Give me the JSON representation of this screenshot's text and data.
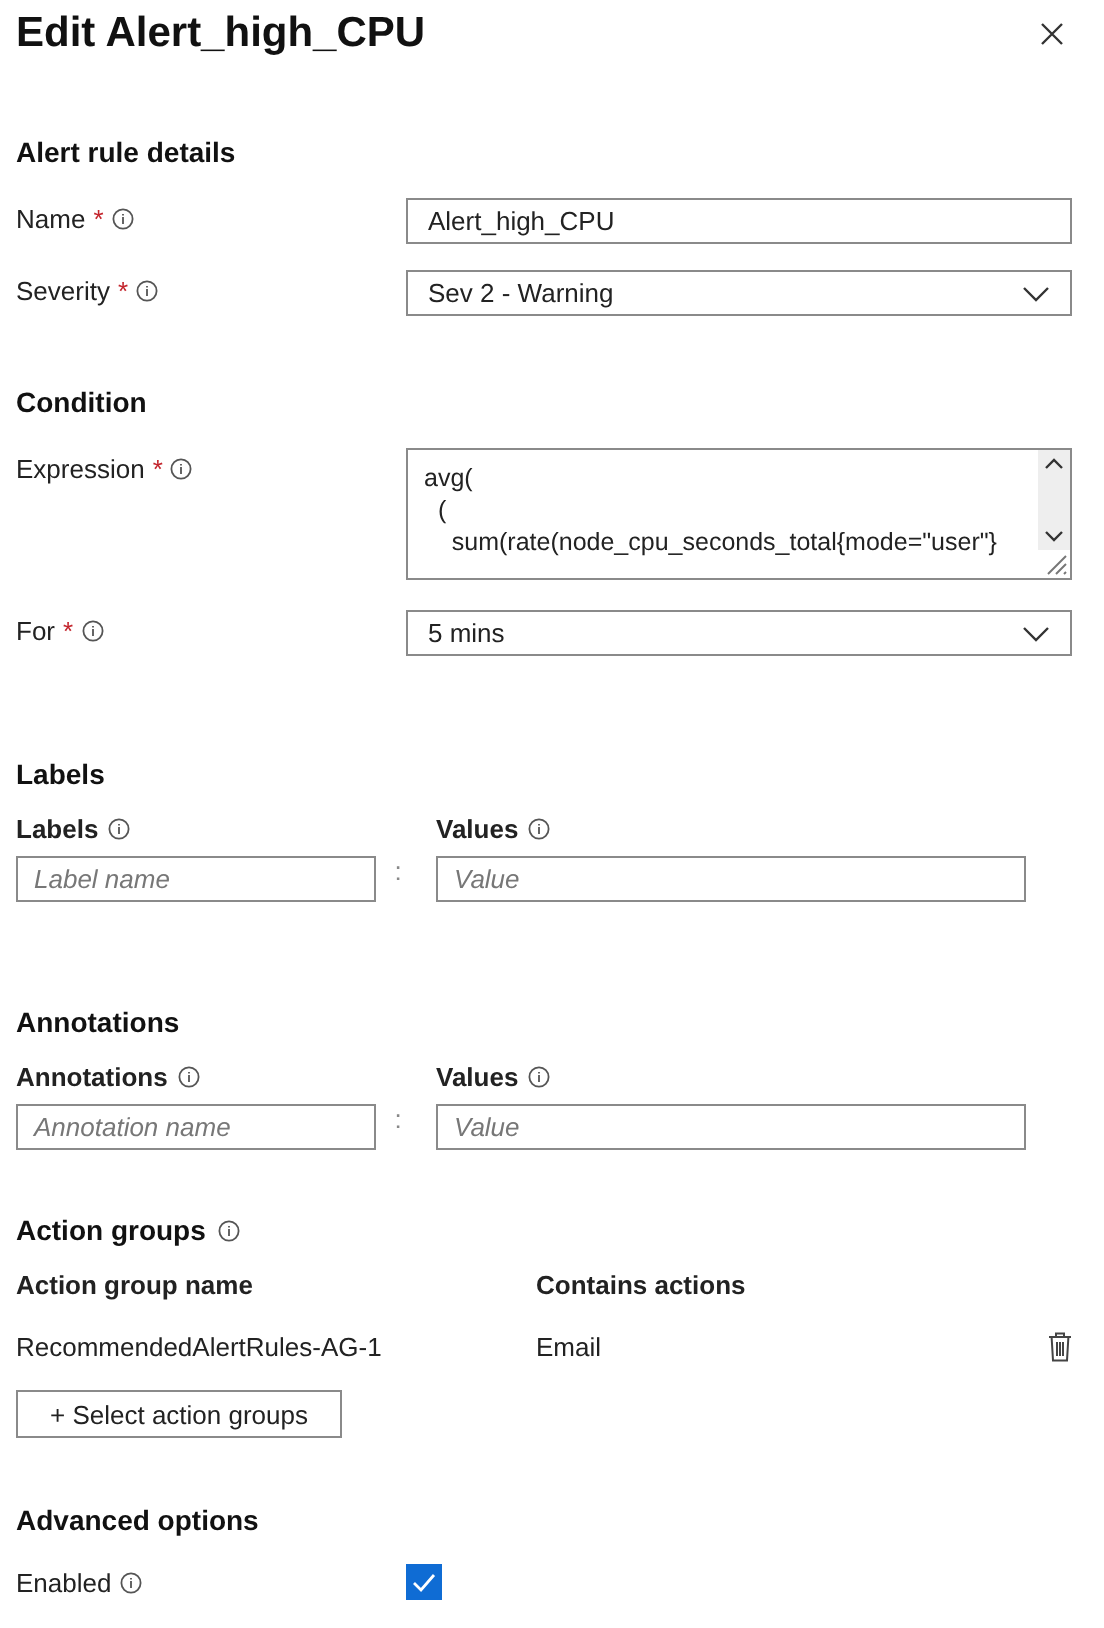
{
  "title": "Edit Alert_high_CPU",
  "sections": [
    {
      "kind": "details",
      "heading": "Alert rule details",
      "fields": [
        {
          "kind": "input",
          "label": "Name",
          "required_mark": "*",
          "value": "Alert_high_CPU"
        },
        {
          "kind": "select",
          "label": "Severity",
          "required_mark": "*",
          "value": "Sev 2 - Warning"
        }
      ]
    },
    {
      "kind": "details",
      "heading": "Condition",
      "fields": [
        {
          "kind": "textarea",
          "label": "Expression",
          "required_mark": "*",
          "lines": [
            "avg(",
            "  (",
            "    sum(rate(node_cpu_seconds_total{mode=\"user\"}"
          ]
        },
        {
          "kind": "select",
          "label": "For",
          "required_mark": "*",
          "value": "5 mins"
        }
      ]
    },
    {
      "kind": "pairs",
      "heading": "Labels",
      "key_label": "Labels",
      "value_label": "Values",
      "key_placeholder": "Label name",
      "value_placeholder": "Value",
      "separator": ":"
    },
    {
      "kind": "pairs",
      "heading": "Annotations",
      "key_label": "Annotations",
      "value_label": "Values",
      "key_placeholder": "Annotation name",
      "value_placeholder": "Value",
      "separator": ":"
    },
    {
      "kind": "actions",
      "heading": "Action groups",
      "columns": [
        "Action group name",
        "Contains actions"
      ],
      "rows": [
        {
          "name": "RecommendedAlertRules-AG-1",
          "actions": "Email"
        }
      ],
      "button": "+ Select action groups"
    },
    {
      "kind": "advanced",
      "heading": "Advanced options",
      "label": "Enabled",
      "checked": true
    }
  ]
}
